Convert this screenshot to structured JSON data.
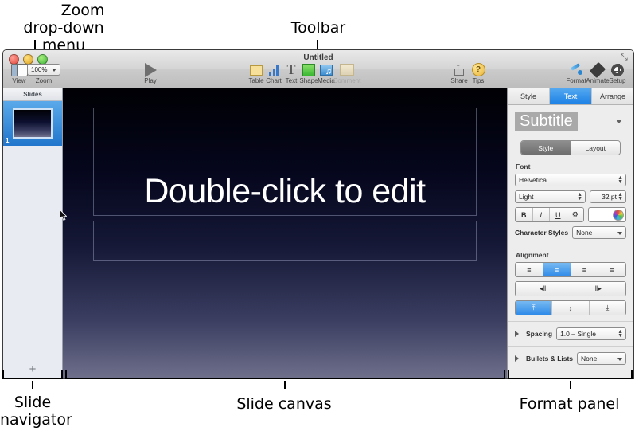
{
  "annotations": {
    "zoom_menu": "Zoom\ndrop-down menu",
    "zoom_menu_line1": "Zoom",
    "zoom_menu_line2": "drop-down menu",
    "toolbar": "Toolbar",
    "slide_navigator_line1": "Slide",
    "slide_navigator_line2": "navigator",
    "slide_canvas": "Slide canvas",
    "format_panel": "Format panel"
  },
  "window": {
    "title": "Untitled"
  },
  "toolbar": {
    "view_label": "View",
    "zoom_label": "Zoom",
    "zoom_value": "100%",
    "play_label": "Play",
    "items": [
      {
        "label": "Table",
        "icon": "table-icon"
      },
      {
        "label": "Chart",
        "icon": "chart-icon"
      },
      {
        "label": "Text",
        "icon": "text-icon"
      },
      {
        "label": "Shape",
        "icon": "shape-icon"
      },
      {
        "label": "Media",
        "icon": "media-icon"
      },
      {
        "label": "Comment",
        "icon": "comment-icon"
      }
    ],
    "share_label": "Share",
    "tips_label": "Tips",
    "tips_glyph": "?",
    "format_label": "Format",
    "animate_label": "Animate",
    "setup_label": "Setup",
    "fullscreen_glyph": "⤡"
  },
  "navigator": {
    "header": "Slides",
    "slide_number": "1",
    "add_slide_glyph": "+"
  },
  "canvas": {
    "title_placeholder": "Double-click to edit",
    "subtitle_placeholder": ""
  },
  "format_panel": {
    "tabs": [
      {
        "label": "Style",
        "active": false
      },
      {
        "label": "Text",
        "active": true
      },
      {
        "label": "Arrange",
        "active": false
      }
    ],
    "style_preview": "Subtitle",
    "segment": [
      {
        "label": "Style",
        "active": true
      },
      {
        "label": "Layout",
        "active": false
      }
    ],
    "font_section": "Font",
    "font_family": "Helvetica",
    "font_weight": "Light",
    "font_size": "32 pt",
    "bold": "B",
    "italic": "I",
    "underline": "U",
    "more_glyph": "⚙",
    "character_styles_label": "Character Styles",
    "character_styles_value": "None",
    "alignment_section": "Alignment",
    "align_buttons": [
      {
        "glyph": "≡",
        "name": "align-left",
        "active": false
      },
      {
        "glyph": "≡",
        "name": "align-center",
        "active": true
      },
      {
        "glyph": "≡",
        "name": "align-right",
        "active": false
      },
      {
        "glyph": "≡",
        "name": "align-justify",
        "active": false
      }
    ],
    "indent_buttons": [
      {
        "glyph": "◂‖",
        "name": "decrease-indent"
      },
      {
        "glyph": "‖▸",
        "name": "increase-indent"
      }
    ],
    "vertical_align_buttons": [
      {
        "glyph": "⤒",
        "name": "align-top",
        "active": true
      },
      {
        "glyph": "↕",
        "name": "align-middle",
        "active": false
      },
      {
        "glyph": "⤓",
        "name": "align-bottom",
        "active": false
      }
    ],
    "spacing_label": "Spacing",
    "spacing_value": "1.0 – Single",
    "bullets_label": "Bullets & Lists",
    "bullets_value": "None"
  },
  "colors": {
    "accent": "#2f8ae8",
    "toolbar_bg": "#d5d5d5",
    "panel_bg": "#ededed",
    "navigator_bg": "#e8ebf1"
  }
}
